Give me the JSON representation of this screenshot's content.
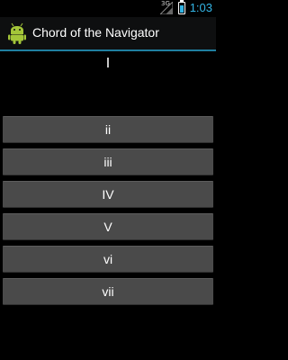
{
  "status_bar": {
    "signal_label": "3G",
    "time": "1:03",
    "time_color": "#33b5e5"
  },
  "action_bar": {
    "icon": "android-robot-icon",
    "title": "Chord of the Navigator"
  },
  "main": {
    "current_chord": "I",
    "buttons": [
      {
        "label": "ii"
      },
      {
        "label": "iii"
      },
      {
        "label": "IV"
      },
      {
        "label": "V"
      },
      {
        "label": "vi"
      },
      {
        "label": "vii"
      }
    ]
  },
  "colors": {
    "background": "#000000",
    "button": "#4a4a4a",
    "action_bar_divider": "#1f7fa0"
  }
}
